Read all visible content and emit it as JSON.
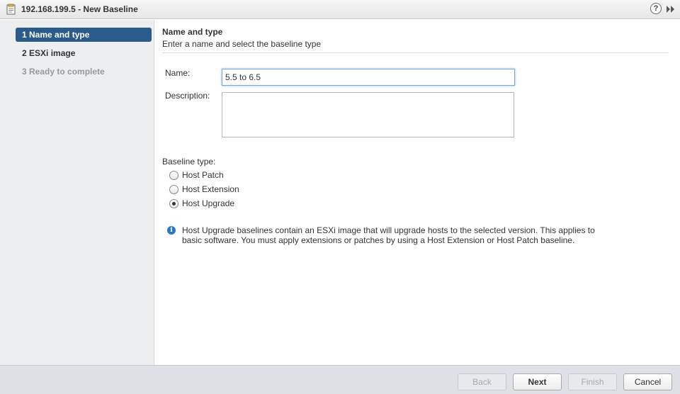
{
  "window": {
    "title": "192.168.199.5 - New Baseline",
    "icon": "baseline-document-icon",
    "help_symbol": "?",
    "expand_icon": "double-chevron-right-icon"
  },
  "sidebar": {
    "steps": [
      {
        "label": "1  Name and type",
        "state": "active"
      },
      {
        "label": "2  ESXi image",
        "state": "enabled"
      },
      {
        "label": "3  Ready to complete",
        "state": "disabled"
      }
    ]
  },
  "content": {
    "title": "Name and type",
    "subtitle": "Enter a name and select the baseline type",
    "name_label": "Name:",
    "name_value": "5.5 to 6.5",
    "description_label": "Description:",
    "description_value": "",
    "baseline_type_label": "Baseline type:",
    "baseline_types": [
      {
        "label": "Host Patch",
        "checked": false
      },
      {
        "label": "Host Extension",
        "checked": false
      },
      {
        "label": "Host Upgrade",
        "checked": true
      }
    ],
    "info_icon_symbol": "i",
    "info_text": "Host Upgrade baselines contain an ESXi image that will upgrade hosts to the selected version. This applies to basic software. You must apply extensions or patches by using a Host Extension or Host Patch baseline."
  },
  "footer": {
    "back_label": "Back",
    "next_label": "Next",
    "finish_label": "Finish",
    "cancel_label": "Cancel"
  },
  "colors": {
    "active_step": "#2a5b8a",
    "sidebar_bg": "#edeef0",
    "footer_bg": "#dfe1e6",
    "info_icon": "#2a78c6"
  }
}
